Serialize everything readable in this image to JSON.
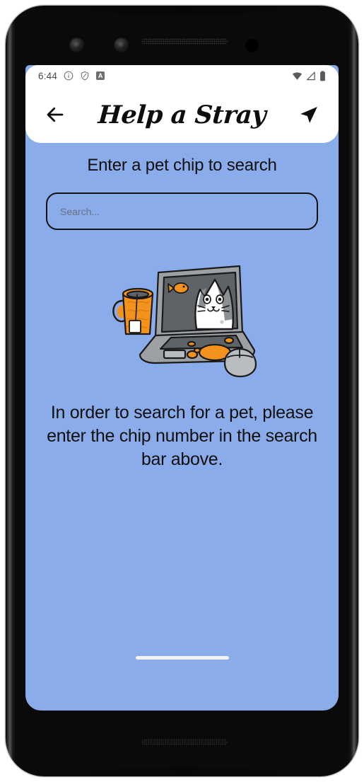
{
  "status_bar": {
    "clock": "6:44",
    "left_icons": [
      "info-circle-icon",
      "shield-icon",
      "app-badge-icon"
    ],
    "app_badge_letter": "A",
    "right_icons": [
      "wifi-icon",
      "cellular-signal-icon",
      "battery-icon"
    ]
  },
  "app_bar": {
    "title": "Help a Stray",
    "back_icon": "arrow-left-icon",
    "send_icon": "paper-plane-icon"
  },
  "main": {
    "heading": "Enter a pet chip to search",
    "search": {
      "placeholder": "Search...",
      "value": ""
    },
    "illustration_alt": "cat-on-laptop-illustration",
    "body_text": "In order to search for a pet, please enter the chip number in the search bar above."
  },
  "colors": {
    "screen_background": "#8BACEA",
    "app_bar_background": "#FFFFFF",
    "text": "#101010",
    "placeholder": "#6A7184",
    "accent_orange": "#F4921E",
    "illustration_gray": "#A9ADB1",
    "illustration_dark_gray": "#5E6367"
  }
}
